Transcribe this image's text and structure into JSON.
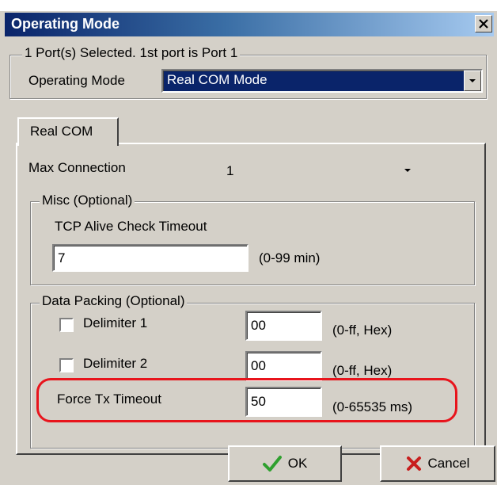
{
  "window": {
    "title": "Operating Mode"
  },
  "ports_group": {
    "legend": "1 Port(s) Selected. 1st port is Port 1"
  },
  "operating_mode": {
    "label": "Operating Mode",
    "value": "Real COM Mode"
  },
  "tabs": [
    {
      "label": "Real COM",
      "selected": true
    }
  ],
  "max_connection": {
    "label": "Max Connection",
    "value": "1"
  },
  "misc": {
    "legend": "Misc (Optional)",
    "tcp_label": "TCP Alive Check Timeout",
    "tcp_value": "7",
    "tcp_range": "(0-99 min)"
  },
  "data_packing": {
    "legend": "Data Packing (Optional)",
    "delimiter1": {
      "label": "Delimiter 1",
      "value": "00",
      "range": "(0-ff, Hex)",
      "checked": false
    },
    "delimiter2": {
      "label": "Delimiter 2",
      "value": "00",
      "range": "(0-ff, Hex)",
      "checked": false
    },
    "force_tx": {
      "label": "Force Tx Timeout",
      "value": "50",
      "range": "(0-65535 ms)"
    }
  },
  "buttons": {
    "ok": "OK",
    "cancel": "Cancel"
  },
  "colors": {
    "titlebar": "#0a246a",
    "selection": "#0a246a",
    "highlight_ring": "#e8141c",
    "ok_check": "#2fa02f",
    "cancel_x": "#c81e1e"
  },
  "icons": {
    "close": "close-icon",
    "dropdown": "chevron-down-icon",
    "ok": "check-icon",
    "cancel": "x-icon"
  }
}
